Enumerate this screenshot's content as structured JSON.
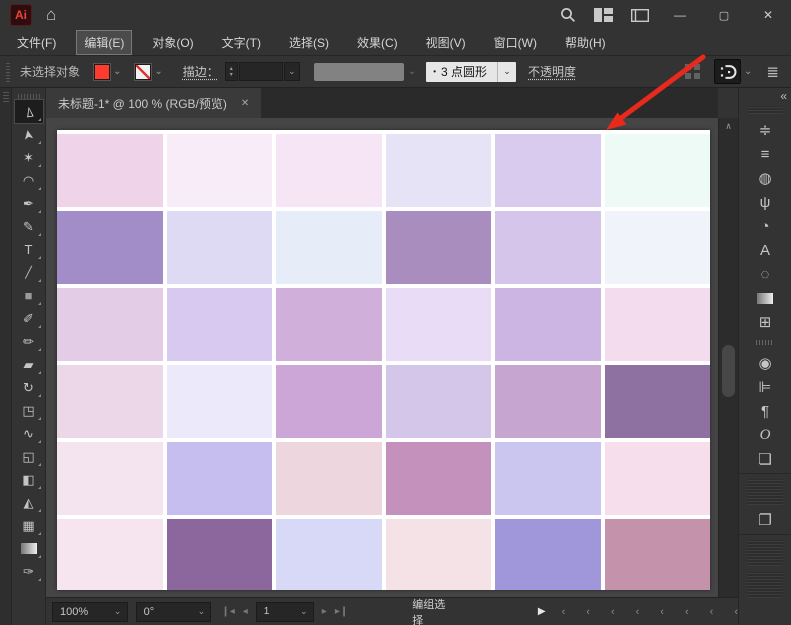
{
  "titlebar": {
    "logo_text": "Ai",
    "home_icon": "⌂",
    "minimize_icon": "—",
    "maximize_icon": "▢",
    "close_icon": "✕"
  },
  "menubar": {
    "items": [
      {
        "id": "file",
        "label": "文件(F)",
        "active": false
      },
      {
        "id": "edit",
        "label": "编辑(E)",
        "active": true
      },
      {
        "id": "object",
        "label": "对象(O)",
        "active": false
      },
      {
        "id": "type",
        "label": "文字(T)",
        "active": false
      },
      {
        "id": "select",
        "label": "选择(S)",
        "active": false
      },
      {
        "id": "effect",
        "label": "效果(C)",
        "active": false
      },
      {
        "id": "view",
        "label": "视图(V)",
        "active": false
      },
      {
        "id": "window",
        "label": "窗口(W)",
        "active": false
      },
      {
        "id": "help",
        "label": "帮助(H)",
        "active": false
      }
    ]
  },
  "options_bar": {
    "status_text": "未选择对象",
    "fill_color": "#ff3b30",
    "stroke_label": "描边：",
    "stepper_up": "▴",
    "stepper_down": "▾",
    "chevron": "⌄",
    "brush_dot": "•",
    "brush_value": "3 点圆形",
    "opacity_label": "不透明度",
    "list_icon": "≣"
  },
  "document_tab": {
    "title": "未标题-1* @ 100 % (RGB/预览)",
    "close_icon": "✕"
  },
  "tools": [
    {
      "name": "selection-tool",
      "glyph": "▻",
      "active": true
    },
    {
      "name": "direct-selection-tool",
      "glyph": "➤"
    },
    {
      "name": "magic-wand-tool",
      "glyph": "✶"
    },
    {
      "name": "lasso-tool",
      "glyph": "◠"
    },
    {
      "name": "pen-tool",
      "glyph": "✒"
    },
    {
      "name": "curvature-tool",
      "glyph": "✎"
    },
    {
      "name": "type-tool",
      "glyph": "T"
    },
    {
      "name": "line-segment-tool",
      "glyph": "╱"
    },
    {
      "name": "rectangle-tool",
      "glyph": "■"
    },
    {
      "name": "paintbrush-tool",
      "glyph": "✐"
    },
    {
      "name": "shaper-tool",
      "glyph": "✏"
    },
    {
      "name": "eraser-tool",
      "glyph": "▰"
    },
    {
      "name": "rotate-tool",
      "glyph": "↻"
    },
    {
      "name": "scale-tool",
      "glyph": "◳"
    },
    {
      "name": "width-tool",
      "glyph": "∿"
    },
    {
      "name": "free-transform-tool",
      "glyph": "◱"
    },
    {
      "name": "shape-builder-tool",
      "glyph": "◧"
    },
    {
      "name": "perspective-grid-tool",
      "glyph": "◭"
    },
    {
      "name": "mesh-tool",
      "glyph": "▦"
    },
    {
      "name": "gradient-tool",
      "glyph": "▤",
      "gradient": true
    },
    {
      "name": "eyedropper-tool",
      "glyph": "✑"
    }
  ],
  "right_rail": {
    "collapse_icon": "«",
    "items": [
      {
        "kind": "grip"
      },
      {
        "kind": "icon",
        "name": "properties-panel-icon",
        "glyph": "≑"
      },
      {
        "kind": "icon",
        "name": "stroke-panel-icon",
        "glyph": "≡"
      },
      {
        "kind": "icon",
        "name": "color-panel-icon",
        "glyph": "◍"
      },
      {
        "kind": "icon",
        "name": "brushes-panel-icon",
        "glyph": "ψ"
      },
      {
        "kind": "icon",
        "name": "swatches-panel-icon",
        "glyph": "◔"
      },
      {
        "kind": "icon",
        "name": "character-panel-icon",
        "glyph": "A"
      },
      {
        "kind": "icon",
        "name": "dashed-selection-icon",
        "glyph": "◌"
      },
      {
        "kind": "icon",
        "name": "gradient-panel-icon",
        "glyph": "▤",
        "gradient": true
      },
      {
        "kind": "icon",
        "name": "transform-panel-icon",
        "glyph": "⊞"
      },
      {
        "kind": "dots"
      },
      {
        "kind": "icon",
        "name": "color-guide-panel-icon",
        "glyph": "◉"
      },
      {
        "kind": "icon",
        "name": "align-panel-icon",
        "glyph": "⊫"
      },
      {
        "kind": "icon",
        "name": "paragraph-panel-icon",
        "glyph": "¶"
      },
      {
        "kind": "icon",
        "name": "opentype-panel-icon",
        "glyph": "O",
        "italic": true
      },
      {
        "kind": "icon",
        "name": "layers-panel-icon",
        "glyph": "❏"
      },
      {
        "kind": "sep"
      },
      {
        "kind": "grip-tall"
      },
      {
        "kind": "icon",
        "name": "artboards-panel-icon",
        "glyph": "❐"
      },
      {
        "kind": "sep"
      },
      {
        "kind": "grip-tall"
      },
      {
        "kind": "grip-tall"
      }
    ]
  },
  "canvas": {
    "grid_colors": [
      [
        "#eed3e9",
        "#f8ecf8",
        "#f6e5f5",
        "#e7e3f7",
        "#d9cbee",
        "#eefaf5"
      ],
      [
        "#a28dc8",
        "#dedaf3",
        "#e7ecf9",
        "#a98dbe",
        "#d5c5ea",
        "#f1f3fb"
      ],
      [
        "#e3cce5",
        "#d8c9f0",
        "#d0b0da",
        "#e9dcf6",
        "#cdb5e3",
        "#f2dcee"
      ],
      [
        "#ecd7e9",
        "#ece9fa",
        "#cba6d6",
        "#d4c6e8",
        "#c7a5d1",
        "#8f71a1"
      ],
      [
        "#f4e4f0",
        "#c6beee",
        "#eed6de",
        "#c391bb",
        "#cbc6f0",
        "#f6deec"
      ],
      [
        "#f6e5ee",
        "#8c679e",
        "#d8d9f6",
        "#f4e2e6",
        "#a096da",
        "#c493ab"
      ]
    ]
  },
  "scrollbars": {
    "up_icon": "∧"
  },
  "status_bar": {
    "zoom": "100%",
    "rotation": "0°",
    "chevron": "⌄",
    "first_icon": "❙◂",
    "prev_icon": "◂",
    "page": "1",
    "next_icon": "▸",
    "last_icon": "▸❙",
    "mode_label": "编组选择",
    "play_icon": "▶",
    "scroll_marks": [
      "‹",
      "‹",
      "‹",
      "‹",
      "‹",
      "‹",
      "‹",
      "‹"
    ]
  },
  "annotation": {
    "arrow_color": "#e8291c"
  }
}
